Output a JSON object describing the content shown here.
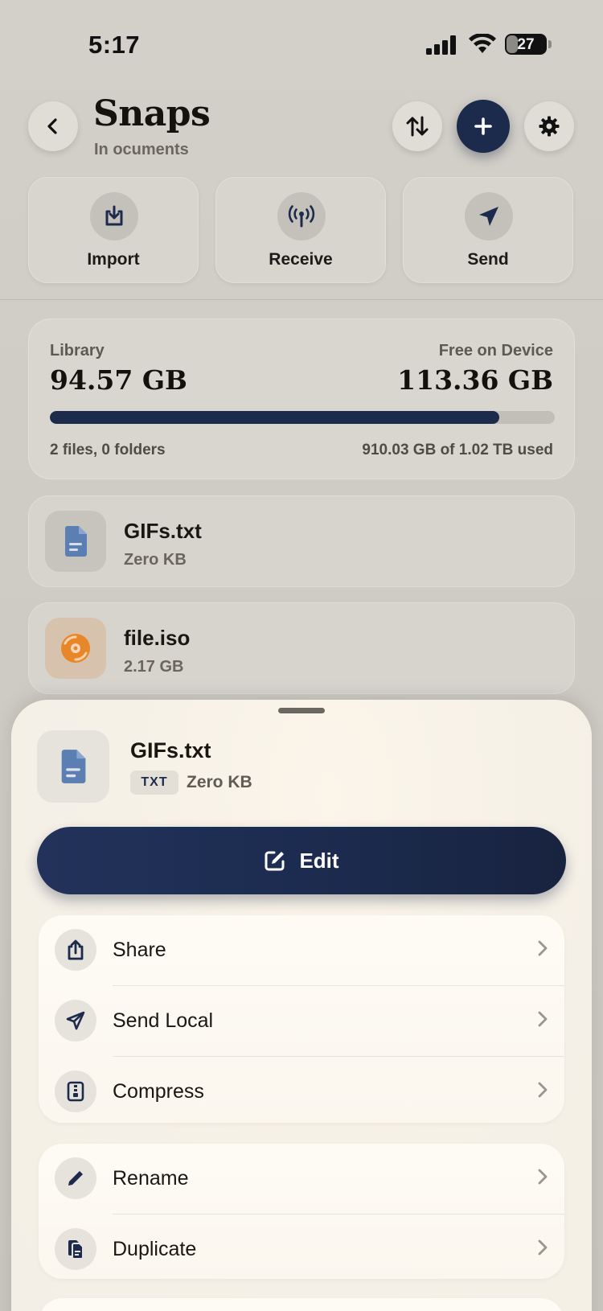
{
  "status_bar": {
    "time": "5:17",
    "battery": "27"
  },
  "header": {
    "title": "Snaps",
    "subtitle": "In ocuments"
  },
  "actions": [
    {
      "label": "Import",
      "icon": "import-icon"
    },
    {
      "label": "Receive",
      "icon": "broadcast-icon"
    },
    {
      "label": "Send",
      "icon": "paper-plane-icon"
    }
  ],
  "storage": {
    "library_label": "Library",
    "library_value": "94.57 GB",
    "free_label": "Free on Device",
    "free_value": "113.36 GB",
    "usage_fraction": 0.89,
    "files_summary": "2 files, 0 folders",
    "used_summary": "910.03 GB of 1.02 TB used"
  },
  "files": [
    {
      "name": "GIFs.txt",
      "size": "Zero KB",
      "icon": "document-icon"
    },
    {
      "name": "file.iso",
      "size": "2.17 GB",
      "icon": "disc-icon"
    }
  ],
  "sheet": {
    "file_name": "GIFs.txt",
    "file_type": "TXT",
    "file_size": "Zero KB",
    "primary_action": "Edit",
    "group1": [
      "Share",
      "Send Local",
      "Compress"
    ],
    "group2": [
      "Rename",
      "Duplicate"
    ]
  },
  "colors": {
    "accent": "#1c2a4b",
    "orange": "#e8872a",
    "doc_blue": "#5b7fb3"
  }
}
